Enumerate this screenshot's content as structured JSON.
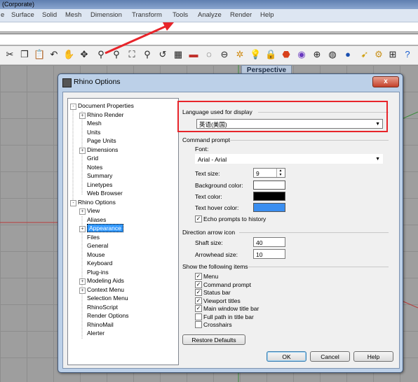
{
  "app": {
    "title": "(Corporate)"
  },
  "menubar": {
    "items": [
      "e",
      "Surface",
      "Solid",
      "Mesh",
      "Dimension",
      "Transform",
      "Tools",
      "Analyze",
      "Render",
      "Help"
    ]
  },
  "viewport": {
    "label": "Perspective"
  },
  "dialog": {
    "title": "Rhino Options",
    "close": "x",
    "tree": [
      {
        "label": "Document Properties",
        "exp": "-"
      },
      {
        "label": "Rhino Render",
        "exp": "+"
      },
      {
        "label": "Mesh"
      },
      {
        "label": "Units"
      },
      {
        "label": "Page Units"
      },
      {
        "label": "Dimensions",
        "exp": "+"
      },
      {
        "label": "Grid"
      },
      {
        "label": "Notes"
      },
      {
        "label": "Summary"
      },
      {
        "label": "Linetypes"
      },
      {
        "label": "Web Browser"
      },
      {
        "label": "Rhino Options",
        "exp": "-"
      },
      {
        "label": "View",
        "exp": "+"
      },
      {
        "label": "Aliases"
      },
      {
        "label": "Appearance",
        "exp": "+",
        "selected": true
      },
      {
        "label": "Files"
      },
      {
        "label": "General"
      },
      {
        "label": "Mouse"
      },
      {
        "label": "Keyboard"
      },
      {
        "label": "Plug-ins"
      },
      {
        "label": "Modeling Aids",
        "exp": "+"
      },
      {
        "label": "Context Menu",
        "exp": "+"
      },
      {
        "label": "Selection Menu"
      },
      {
        "label": "RhinoScript"
      },
      {
        "label": "Render Options"
      },
      {
        "label": "RhinoMail"
      },
      {
        "label": "Alerter"
      }
    ],
    "language": {
      "section": "Language used for display",
      "value": "英语(美国)"
    },
    "command_prompt": {
      "section": "Command prompt",
      "font_label": "Font:",
      "font_value": "Arial - Arial",
      "text_size_label": "Text size:",
      "text_size_value": "9",
      "bg_color_label": "Background color:",
      "text_color_label": "Text color:",
      "hover_color_label": "Text hover color:",
      "echo_label": "Echo prompts to history",
      "colors": {
        "background": "#ffffff",
        "text": "#000000",
        "hover": "#3a8ef0"
      }
    },
    "direction_arrow": {
      "section": "Direction arrow icon",
      "shaft_label": "Shaft size:",
      "shaft_value": "40",
      "arrowhead_label": "Arrowhead size:",
      "arrowhead_value": "10"
    },
    "show_items": {
      "section": "Show the following items",
      "items": [
        {
          "label": "Menu",
          "checked": true
        },
        {
          "label": "Command prompt",
          "checked": true
        },
        {
          "label": "Status bar",
          "checked": true
        },
        {
          "label": "Viewport titles",
          "checked": true
        },
        {
          "label": "Main window title bar",
          "checked": true
        },
        {
          "label": "Full path in title bar",
          "checked": false
        },
        {
          "label": "Crosshairs",
          "checked": false
        }
      ]
    },
    "buttons": {
      "restore": "Restore Defaults",
      "ok": "OK",
      "cancel": "Cancel",
      "help": "Help"
    }
  }
}
